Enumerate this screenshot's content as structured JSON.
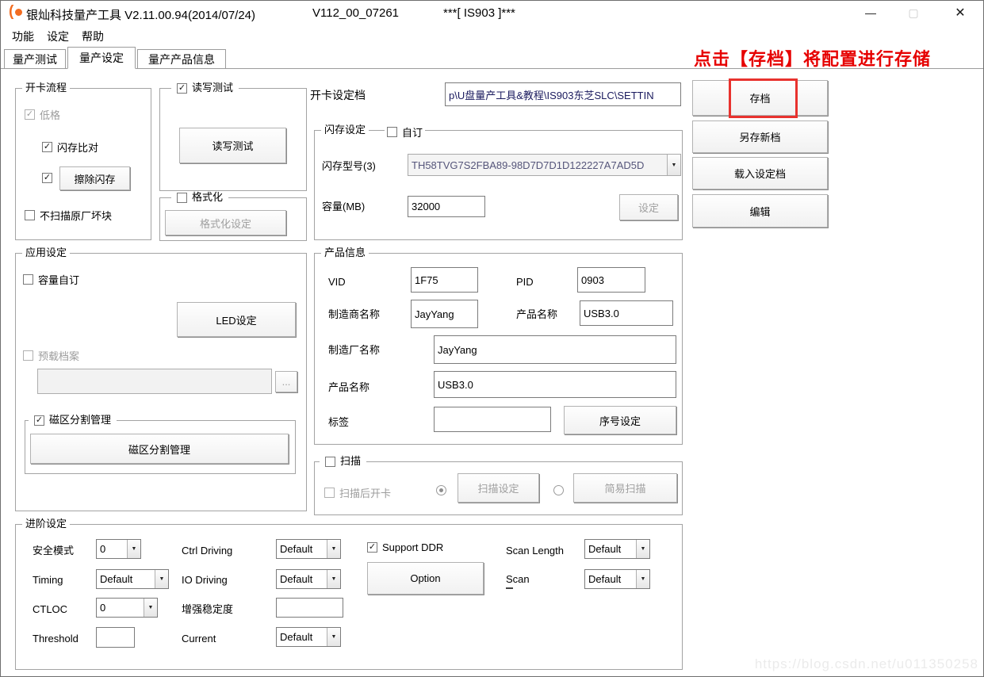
{
  "window": {
    "title": "银灿科技量产工具 V2.11.00.94(2014/07/24)",
    "version": "V112_00_07261",
    "chip": "***[ IS903 ]***",
    "minimize": "—",
    "maximize": "▢",
    "close": "✕"
  },
  "icons": {
    "check": "✓",
    "dropdown": "▼",
    "browse": "..."
  },
  "menu": {
    "items": [
      "功能",
      "设定",
      "帮助"
    ]
  },
  "tabs": {
    "test": "量产测试",
    "settings": "量产设定",
    "product_info": "量产产品信息"
  },
  "annotation": "点击【存档】将配置进行存储",
  "card_flow": {
    "title": "开卡流程",
    "low_format": "低格",
    "flash_compare": "闪存比对",
    "erase_flash": "擦除闪存",
    "no_scan_bad_blocks": "不扫描原厂坏块"
  },
  "rw_test": {
    "title": "读写测试",
    "button": "读写测试"
  },
  "format": {
    "title": "格式化",
    "button": "格式化设定"
  },
  "app_settings": {
    "title": "应用设定",
    "capacity_custom": "容量自订",
    "led_button": "LED设定",
    "preload_file": "预载档案",
    "preload_value": "",
    "partition_title": "磁区分割管理",
    "partition_button": "磁区分割管理"
  },
  "settings_file": {
    "label": "开卡设定档",
    "value": "p\\U盘量产工具&教程\\IS903东芝SLC\\SETTIN"
  },
  "flash_settings": {
    "title": "闪存设定",
    "custom": "自订",
    "model_label": "闪存型号(3)",
    "model_value": "TH58TVG7S2FBA89-98D7D7D1D122227A7AD5D",
    "capacity_label": "容量(MB)",
    "capacity_value": "32000",
    "set_button": "设定"
  },
  "product_info": {
    "title": "产品信息",
    "vid_label": "VID",
    "vid_value": "1F75",
    "pid_label": "PID",
    "pid_value": "0903",
    "vendor_label": "制造商名称",
    "vendor_value": "JayYang",
    "product_label": "产品名称",
    "product_value": "USB3.0",
    "factory_label": "制造厂名称",
    "factory_value": "JayYang",
    "product2_label": "产品名称",
    "product2_value": "USB3.0",
    "tag_label": "标签",
    "tag_value": "",
    "serial_button": "序号设定"
  },
  "scan_group": {
    "title": "扫描",
    "open_after_scan": "扫描后开卡",
    "scan_set_button": "扫描设定",
    "easy_scan_button": "简易扫描"
  },
  "advanced": {
    "title": "进阶设定",
    "safe_mode_label": "安全模式",
    "safe_mode_value": "0",
    "ctrl_driving_label": "Ctrl Driving",
    "ctrl_driving_value": "Default",
    "support_ddr": "Support DDR",
    "scan_length_label": "Scan Length",
    "scan_length_value": "Default",
    "timing_label": "Timing",
    "timing_value": "Default",
    "io_driving_label": "IO Driving",
    "io_driving_value": "Default",
    "option_button": "Option",
    "scan_label": "Scan",
    "scan_value": "Default",
    "ctloc_label": "CTLOC",
    "ctloc_value": "0",
    "stability_label": "增强稳定度",
    "stability_value": "",
    "threshold_label": "Threshold",
    "threshold_value": "",
    "current_label": "Current",
    "current_value": "Default"
  },
  "side_buttons": {
    "save": "存档",
    "save_as": "另存新档",
    "load": "载入设定档",
    "edit": "编辑"
  },
  "watermark": "https://blog.csdn.net/u011350258",
  "colors": {
    "accent_orange": "#f26c21",
    "annotation_red": "#e60000",
    "highlight_red": "#e8322e"
  }
}
